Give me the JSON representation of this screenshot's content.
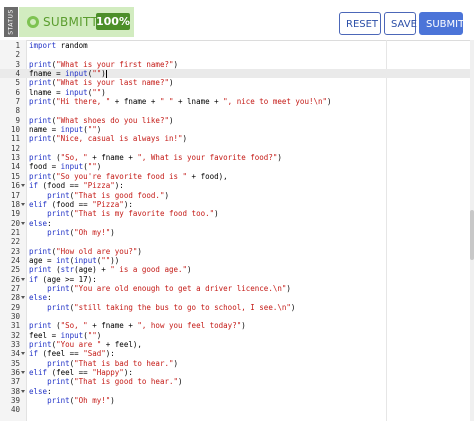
{
  "status": {
    "tab_label": "STATUS",
    "state": "SUBMITTED",
    "percent": "100%"
  },
  "buttons": {
    "reset": "RESET",
    "save": "SAVE",
    "submit": "SUBMIT"
  },
  "editor": {
    "active_line": 4,
    "fold_lines": [
      16,
      18,
      20,
      26,
      28,
      34,
      36,
      38
    ],
    "lines": [
      "import random",
      "",
      "print(\"What is your first name?\")",
      "fname = input(\"\")",
      "print(\"What is your last name?\")",
      "lname = input(\"\")",
      "print(\"Hi there, \" + fname + \" \" + lname + \", nice to meet you!\\n\")",
      "",
      "print(\"What shoes do you like?\")",
      "name = input(\"\")",
      "print(\"Nice, casual is always in!\")",
      "",
      "print (\"So, \" + fname + \", What is your favorite food?\")",
      "food = input(\"\")",
      "print(\"So you're favorite food is \" + food),",
      "if (food == \"Pizza\"):",
      "    print(\"That is good food.\")",
      "elif (food == \"Pizza\"):",
      "    print(\"That is my favorite food too.\")",
      "else:",
      "    print(\"Oh my!\")",
      "",
      "print(\"How old are you?\")",
      "age = int(input(\"\"))",
      "print (str(age) + \" is a good age.\")",
      "if (age >= 17):",
      "    print(\"You are old enough to get a driver licence.\\n\")",
      "else:",
      "    print(\"still taking the bus to go to school, I see.\\n\")",
      "",
      "print (\"So, \" + fname + \", how you feel today?\")",
      "feel = input(\"\")",
      "print(\"You are \" + feel),",
      "if (feel == \"Sad\"):",
      "    print(\"That is bad to hear.\")",
      "elif (feel == \"Happy\"):",
      "    print(\"That is good to hear.\")",
      "else:",
      "    print(\"Oh my!\")",
      ""
    ]
  }
}
